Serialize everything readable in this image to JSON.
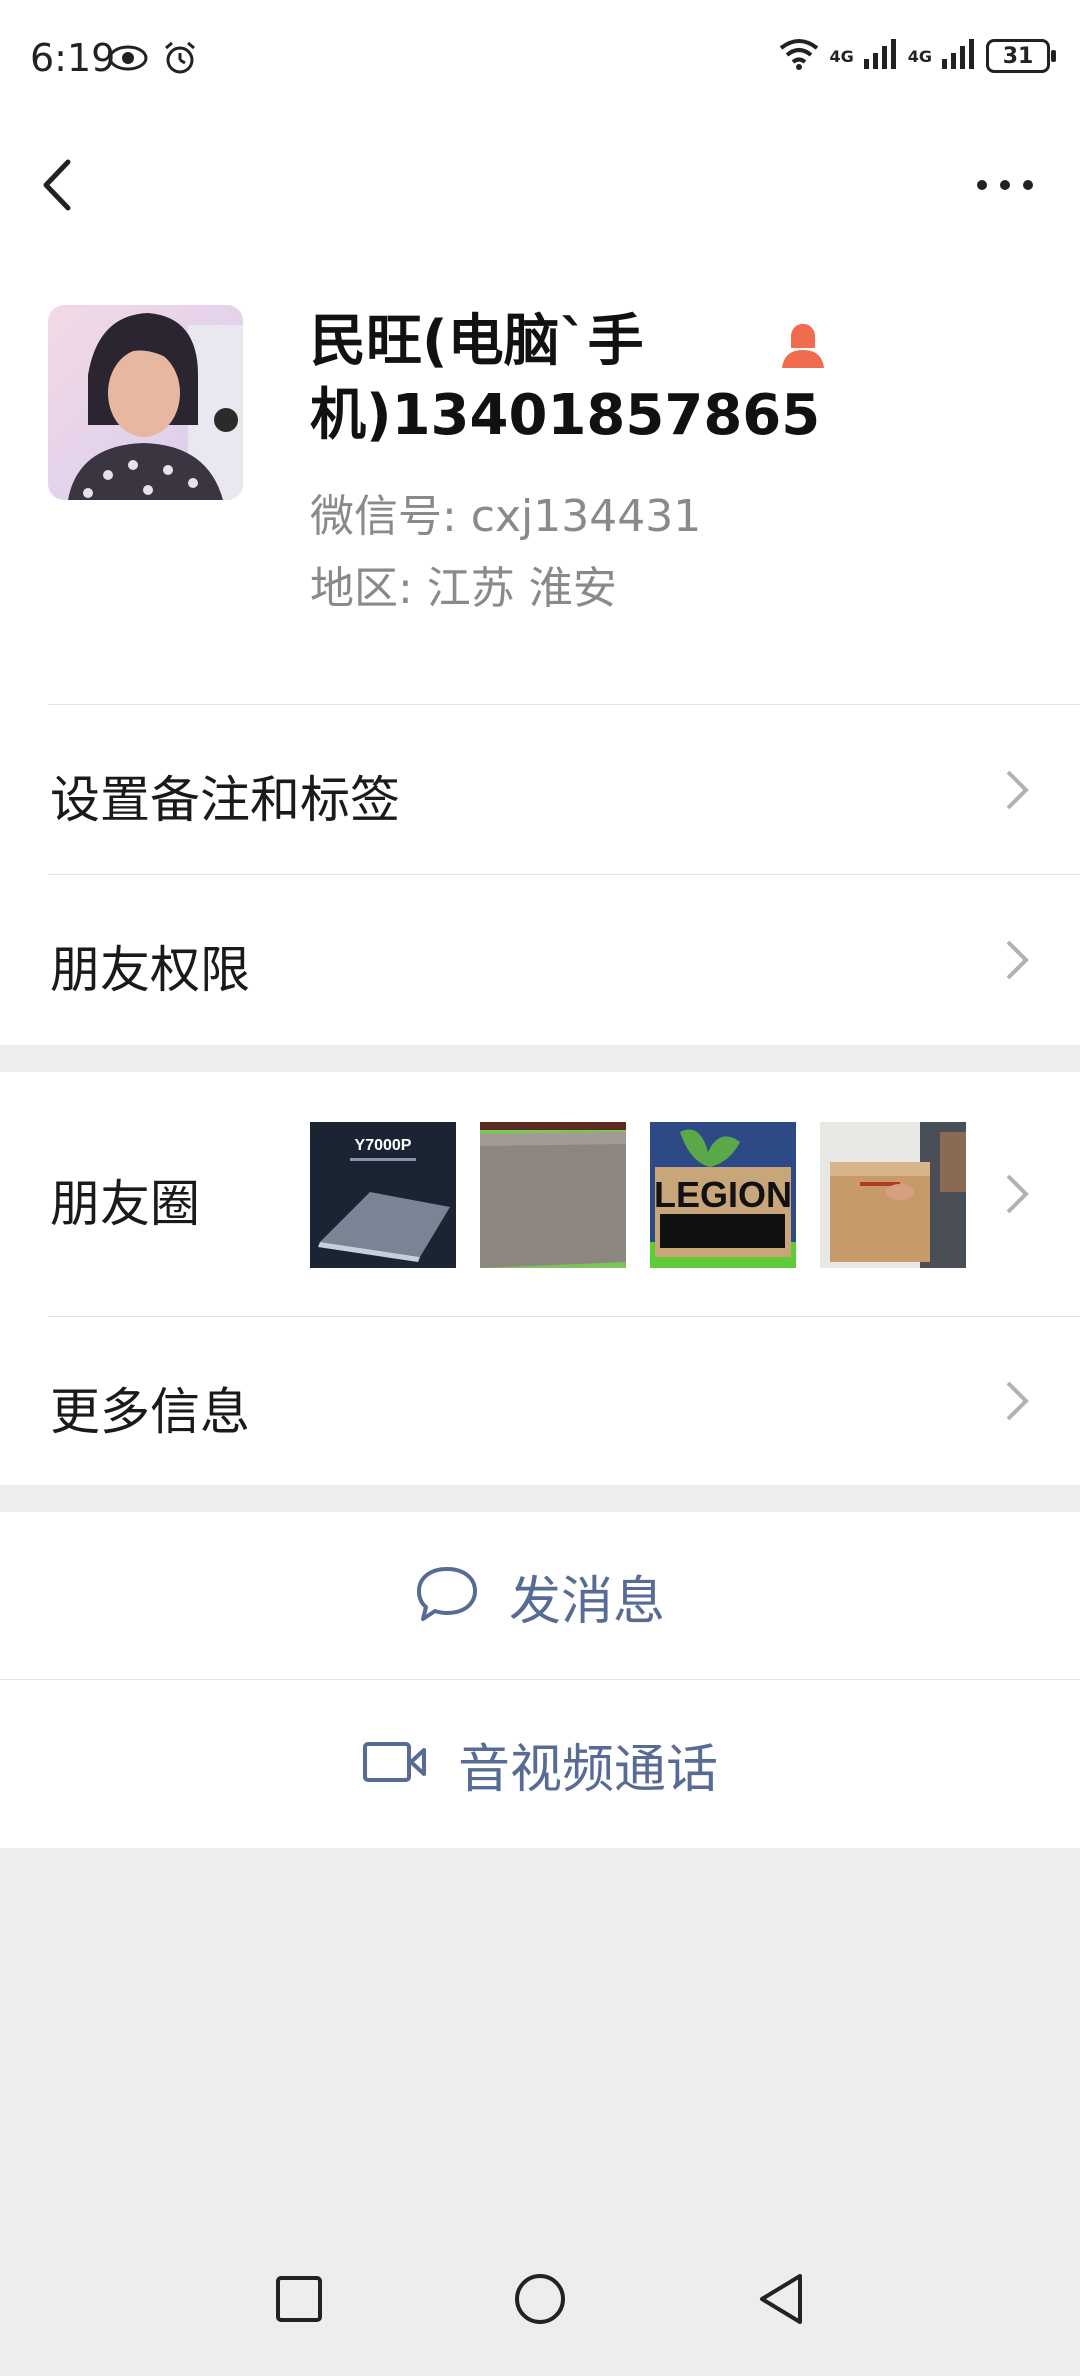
{
  "status_bar": {
    "time": "6:19",
    "network_1": "4G",
    "network_2": "4G",
    "battery": "31"
  },
  "title_bar": {
    "back_icon": "back-arrow-icon",
    "more_icon": "more-options-icon"
  },
  "profile": {
    "name_line1": "民旺(电脑`手",
    "name_line2": "机)13401857865",
    "wechat_id": "微信号: cxj134431",
    "region": "地区: 江苏  淮安",
    "gender_icon": "female-user-icon",
    "gender_color": "#f16b4e"
  },
  "rows": {
    "remark": "设置备注和标签",
    "permissions": "朋友权限",
    "moments": "朋友圈",
    "more_info": "更多信息"
  },
  "moments_thumbs": [
    {
      "name": "moment-thumb-1",
      "caption": "Y7000P"
    },
    {
      "name": "moment-thumb-2",
      "caption": ""
    },
    {
      "name": "moment-thumb-3",
      "caption": "LEGION"
    },
    {
      "name": "moment-thumb-4",
      "caption": ""
    }
  ],
  "actions": {
    "message": "发消息",
    "video_call": "音视频通话",
    "link_color": "#576b95"
  },
  "nav": {
    "recent_icon": "recent-apps-icon",
    "home_icon": "home-icon",
    "back_icon": "nav-back-icon"
  }
}
